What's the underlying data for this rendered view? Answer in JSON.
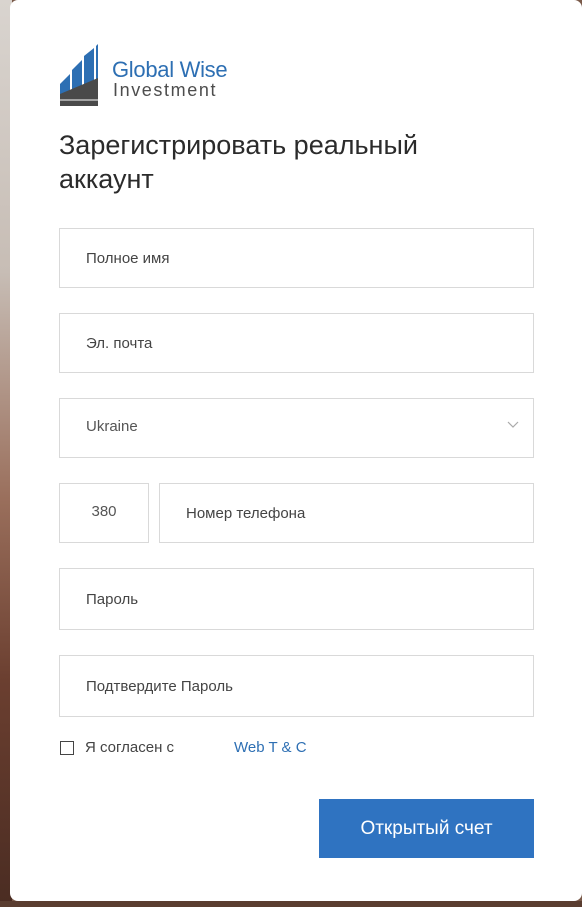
{
  "logo": {
    "line1": "Global Wise",
    "line2": "Investment",
    "brand_color": "#2d6fb3"
  },
  "form": {
    "title": "Зарегистрировать реальный аккаунт",
    "full_name_placeholder": "Полное имя",
    "email_placeholder": "Эл. почта",
    "country_value": "Ukraine",
    "phone_code": "380",
    "phone_placeholder": "Номер телефона",
    "password_placeholder": "Пароль",
    "confirm_password_placeholder": "Подтвердите Пароль",
    "agree_text": "Я согласен с",
    "agree_link": "Web T & C",
    "agree_checked": false,
    "submit_label": "Открытый счет",
    "accent_color": "#2f73c1"
  }
}
